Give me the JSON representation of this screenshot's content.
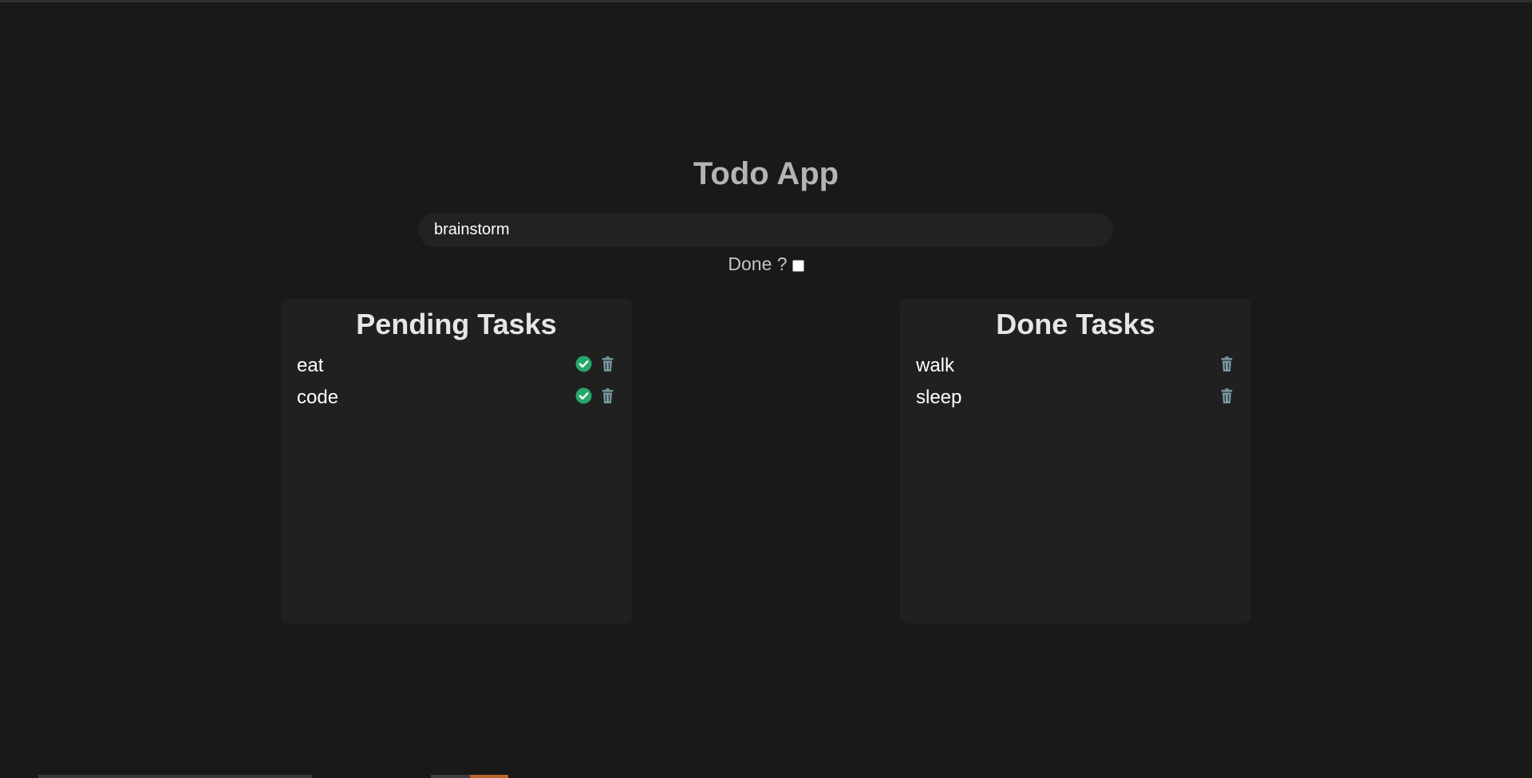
{
  "app": {
    "title": "Todo App"
  },
  "form": {
    "task_value": "brainstorm",
    "done_label": "Done ?",
    "done_checked": false
  },
  "pending": {
    "title": "Pending Tasks",
    "tasks": [
      {
        "name": "eat",
        "icons": [
          "check-circle-icon",
          "trash-icon"
        ]
      },
      {
        "name": "code",
        "icons": [
          "check-circle-icon",
          "trash-icon"
        ]
      }
    ]
  },
  "done": {
    "title": "Done Tasks",
    "tasks": [
      {
        "name": "walk",
        "icons": [
          "trash-icon"
        ]
      },
      {
        "name": "sleep",
        "icons": [
          "trash-icon"
        ]
      }
    ]
  },
  "colors": {
    "background": "#191919",
    "panel": "#202020",
    "check": "#27a768",
    "trash": "#7a98a3"
  }
}
